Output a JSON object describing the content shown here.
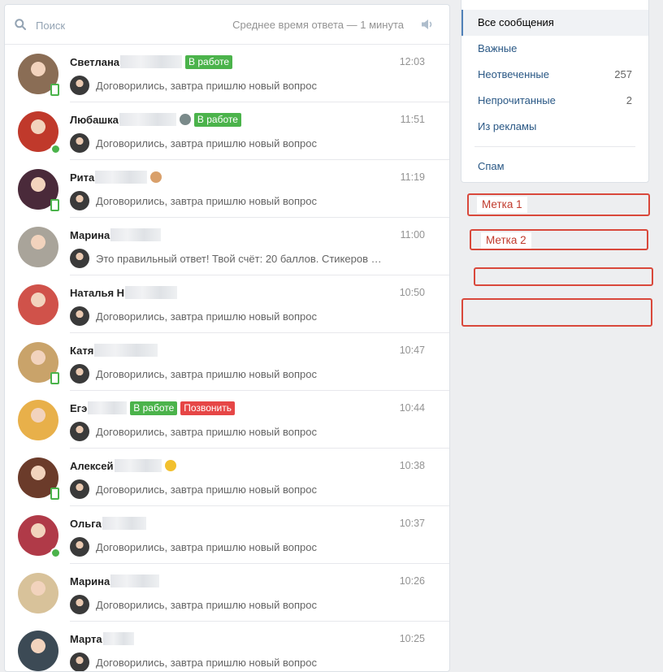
{
  "search": {
    "placeholder": "Поиск"
  },
  "header": {
    "avg_response": "Среднее время ответа — 1 минута"
  },
  "dialogs": [
    {
      "name": "Светлана",
      "time": "12:03",
      "message": "Договорились, завтра пришлю новый вопрос",
      "tags": [
        {
          "text": "В работе",
          "color": "#4bb34b"
        }
      ],
      "status": "mobile",
      "avatar_color": "#8a6d55"
    },
    {
      "name": "Любашка",
      "time": "11:51",
      "message": "Договорились, завтра пришлю новый вопрос",
      "tags": [
        {
          "text": "В работе",
          "color": "#4bb34b"
        }
      ],
      "status": "online",
      "avatar_color": "#c0392b"
    },
    {
      "name": "Рита",
      "time": "11:19",
      "message": "Договорились, завтра пришлю новый вопрос",
      "tags": [],
      "status": "mobile",
      "avatar_color": "#4a2a3a"
    },
    {
      "name": "Марина",
      "time": "11:00",
      "message": "Это правильный ответ! Твой счёт: 20 баллов. Стикеров …",
      "tags": [],
      "status": "none",
      "avatar_color": "#a9a49a"
    },
    {
      "name": "Наталья Н",
      "time": "10:50",
      "message": "Договорились, завтра пришлю новый вопрос",
      "tags": [],
      "status": "none",
      "avatar_color": "#d0524a"
    },
    {
      "name": "Катя",
      "time": "10:47",
      "message": "Договорились, завтра пришлю новый вопрос",
      "tags": [],
      "status": "mobile",
      "avatar_color": "#c9a36a"
    },
    {
      "name": "Егэ",
      "time": "10:44",
      "message": "Договорились, завтра пришлю новый вопрос",
      "tags": [
        {
          "text": "В работе",
          "color": "#4bb34b"
        },
        {
          "text": "Позвонить",
          "color": "#e64646"
        }
      ],
      "status": "none",
      "avatar_color": "#e8b04a"
    },
    {
      "name": "Алексей",
      "time": "10:38",
      "message": "Договорились, завтра пришлю новый вопрос",
      "tags": [],
      "status": "mobile",
      "avatar_color": "#6b3b2a"
    },
    {
      "name": "Ольга",
      "time": "10:37",
      "message": "Договорились, завтра пришлю новый вопрос",
      "tags": [],
      "status": "online",
      "avatar_color": "#b03a48"
    },
    {
      "name": "Марина",
      "time": "10:26",
      "message": "Договорились, завтра пришлю новый вопрос",
      "tags": [],
      "status": "none",
      "avatar_color": "#d8c29a"
    },
    {
      "name": "Марта",
      "time": "10:25",
      "message": "Договорились, завтра пришлю новый вопрос",
      "tags": [],
      "status": "none",
      "avatar_color": "#3c4a55"
    }
  ],
  "menu": {
    "all": "Все сообщения",
    "important": "Важные",
    "unanswered": "Неотвеченные",
    "unanswered_count": "257",
    "unread": "Непрочитанные",
    "unread_count": "2",
    "ads": "Из рекламы",
    "spam": "Спам"
  },
  "labels": {
    "label1": "Метка 1",
    "label2": "Метка 2"
  },
  "colors": {
    "accent": "#5181b8",
    "link": "#2a5885",
    "online": "#4bb34b",
    "label_border": "#d9483b"
  }
}
